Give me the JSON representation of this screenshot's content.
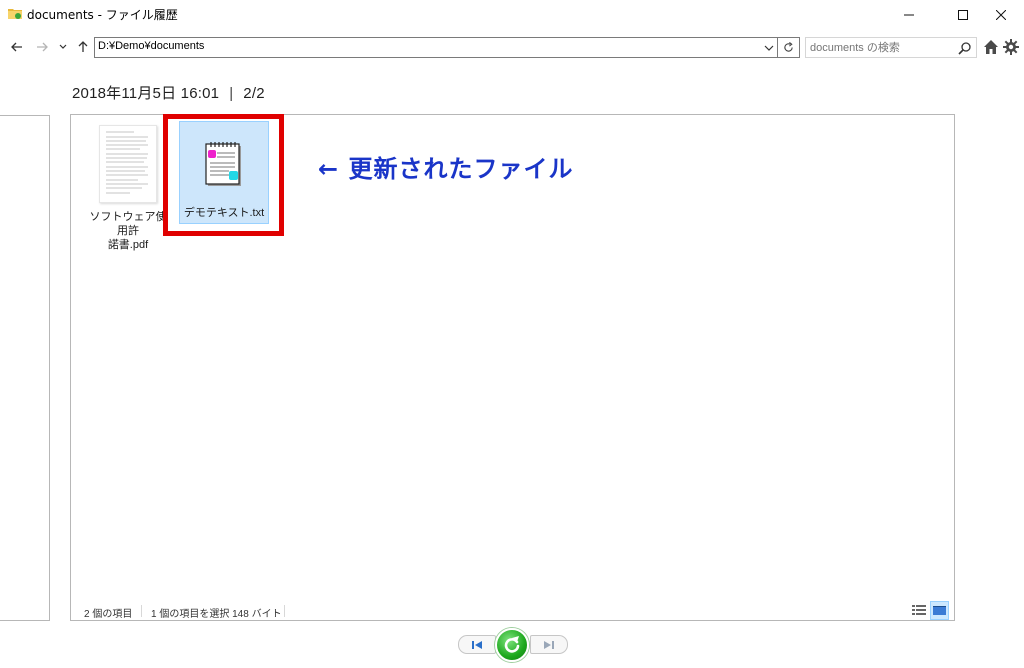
{
  "window": {
    "title": "documents - ファイル履歴",
    "minimize_icon": "minimize-icon",
    "maximize_icon": "maximize-icon",
    "close_icon": "close-icon"
  },
  "nav": {
    "address": "D:¥Demo¥documents",
    "search_placeholder": "documents の検索"
  },
  "header": {
    "datetime": "2018年11月5日 16:01",
    "separator": "|",
    "version": "2/2"
  },
  "files": [
    {
      "name": "ソフトウェア使用許諾書.pdf",
      "line1": "ソフトウェア使用許",
      "line2": "諾書.pdf",
      "icon": "pdf-thumbnail",
      "selected": false
    },
    {
      "name": "デモテキスト.txt",
      "icon": "text-file-icon",
      "selected": true
    }
  ],
  "annotation": {
    "text": "← 更新されたファイル",
    "color": "#1a35c8",
    "box_color": "#e00000"
  },
  "status": {
    "count": "2 個の項目",
    "selected": "1 個の項目を選択  148 バイト"
  },
  "colors": {
    "selection": "#cde6fb",
    "restore_green": "#1da81d"
  }
}
